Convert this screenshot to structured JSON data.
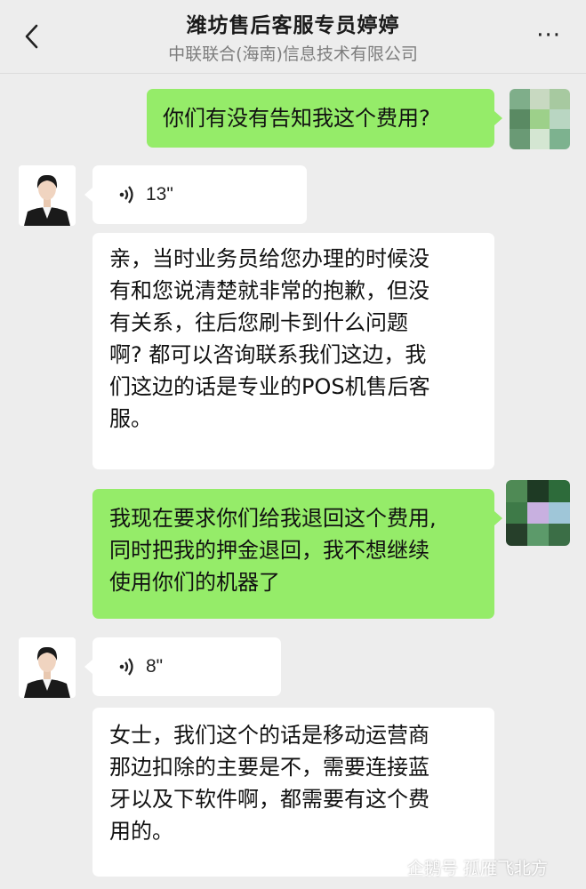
{
  "header": {
    "title": "潍坊售后客服专员婷婷",
    "subtitle": "中联联合(海南)信息技术有限公司",
    "more_label": "···"
  },
  "messages": [
    {
      "sender": "me",
      "type": "text",
      "text": "你们有没有告知我这个费用?"
    },
    {
      "sender": "agent",
      "type": "voice",
      "duration": "13\""
    },
    {
      "sender": "agent",
      "type": "text",
      "lines": [
        "亲，当时业务员给您办理的时候没",
        "有和您说清楚就非常的抱歉，但没",
        "有关系，往后您刷卡到什么问题",
        "啊? 都可以咨询联系我们这边，我",
        "们这边的话是专业的POS机售后客",
        "服。"
      ]
    },
    {
      "sender": "me",
      "type": "text",
      "lines": [
        "我现在要求你们给我退回这个费用,",
        "同时把我的押金退回，我不想继续",
        "使用你们的机器了"
      ]
    },
    {
      "sender": "agent",
      "type": "voice",
      "duration": "8\""
    },
    {
      "sender": "agent",
      "type": "text",
      "lines": [
        "女士，我们这个的话是移动运营商",
        "那边扣除的主要是不，需要连接蓝",
        "牙以及下软件啊，都需要有这个费",
        "用的。"
      ]
    }
  ],
  "watermark": {
    "text": "企鹅号 孤雁飞北方"
  },
  "colors": {
    "my_bubble": "#95ec69",
    "agent_bubble": "#ffffff",
    "background": "#ededed"
  }
}
